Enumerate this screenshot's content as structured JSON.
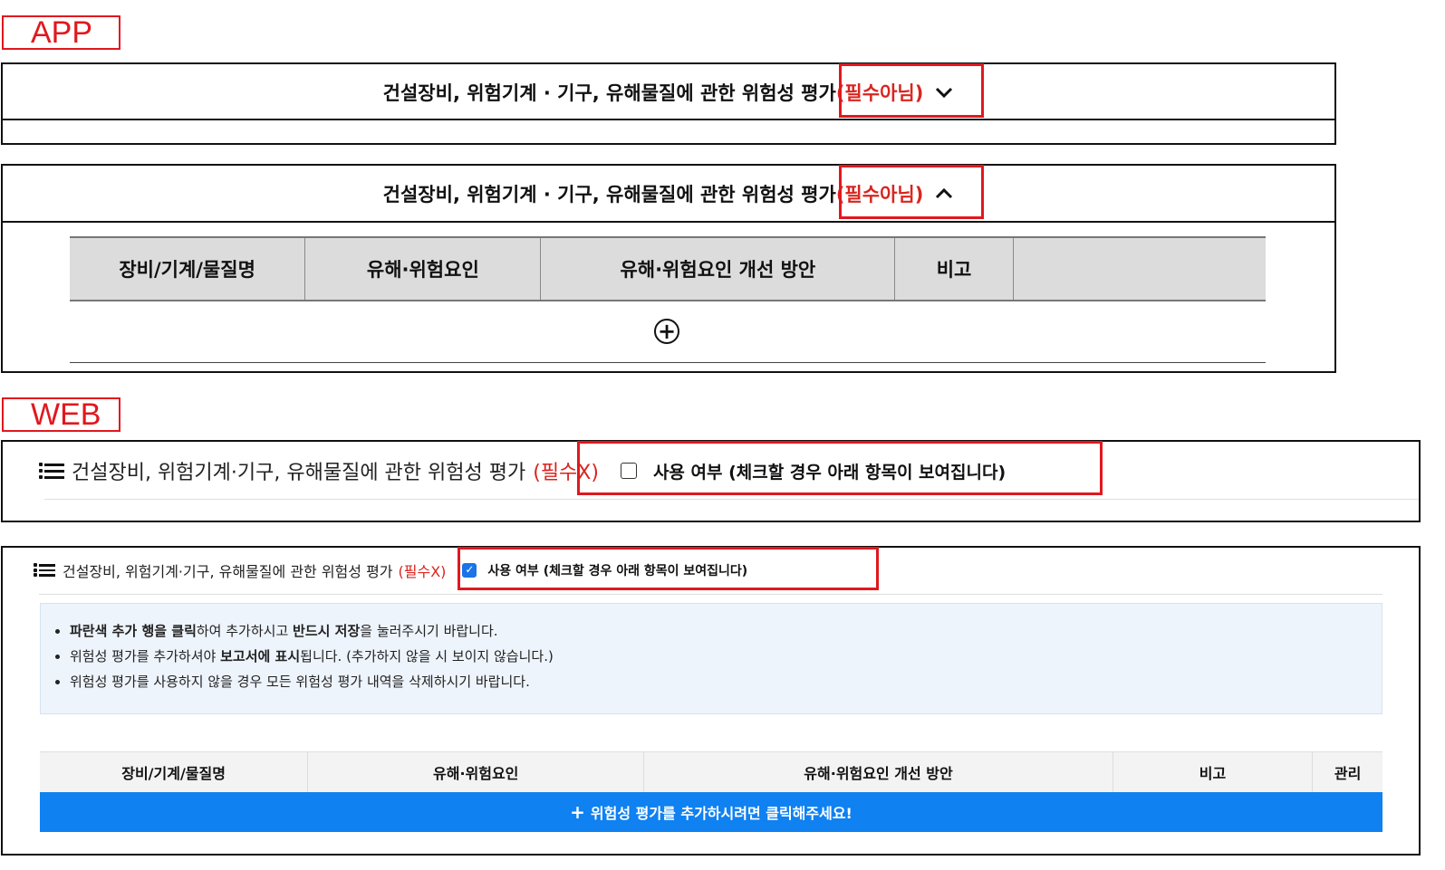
{
  "labels": {
    "app": "APP",
    "web": "WEB"
  },
  "app": {
    "collapsed": {
      "title": "건설장비, 위험기계 · 기구, 유해물질에 관한 위험성 평가",
      "required": "(필수아님)",
      "toggle_icon": "chevron-down-icon"
    },
    "expanded": {
      "title": "건설장비, 위험기계 · 기구, 유해물질에 관한 위험성 평가",
      "required": "(필수아님)",
      "toggle_icon": "chevron-up-icon",
      "columns": [
        "장비/기계/물질명",
        "유해·위험요인",
        "유해·위험요인 개선 방안",
        "비고",
        ""
      ],
      "add_icon": "plus-circle-icon"
    }
  },
  "web": {
    "collapsed": {
      "title": "건설장비, 위험기계·기구, 유해물질에 관한 위험성 평가",
      "required": "(필수X)",
      "checkbox_label": "사용 여부 (체크할 경우 아래 항목이 보여집니다)",
      "checked": false
    },
    "expanded": {
      "title": "건설장비, 위험기계·기구, 유해물질에 관한 위험성 평가",
      "required": "(필수X)",
      "checkbox_label": "사용 여부 (체크할 경우 아래 항목이 보여집니다)",
      "checked": true,
      "info": {
        "line1_b1": "파란색 추가 행을 클릭",
        "line1_t1": "하여 추가하시고 ",
        "line1_b2": "반드시 저장",
        "line1_t2": "을 눌러주시기 바랍니다.",
        "line2_t1": "위험성 평가를 추가하셔야 ",
        "line2_b1": "보고서에 표시",
        "line2_t2": "됩니다. (추가하지 않을 시 보이지 않습니다.)",
        "line3": "위험성 평가를 사용하지 않을 경우 모든 위험성 평가 내역을 삭제하시기 바랍니다."
      },
      "columns": [
        "장비/기계/물질명",
        "유해·위험요인",
        "유해·위험요인 개선 방안",
        "비고",
        "관리"
      ],
      "add_row": "위험성 평가를 추가하시려면 클릭해주세요!"
    }
  },
  "colors": {
    "annotation_red": "#e0181e",
    "required_red": "#d9251f",
    "add_bar_blue": "#0f81f1",
    "checkbox_blue": "#1a73e8"
  }
}
